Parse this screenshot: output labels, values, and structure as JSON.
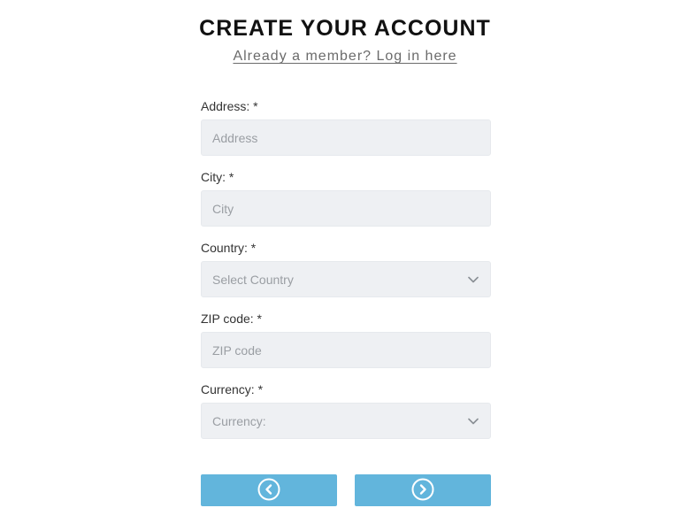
{
  "header": {
    "title": "CREATE YOUR ACCOUNT",
    "login_link": "Already a member? Log in here"
  },
  "form": {
    "address": {
      "label": "Address: *",
      "placeholder": "Address",
      "value": ""
    },
    "city": {
      "label": "City: *",
      "placeholder": "City",
      "value": ""
    },
    "country": {
      "label": "Country: *",
      "selected": "Select Country"
    },
    "zip": {
      "label": "ZIP code: *",
      "placeholder": "ZIP code",
      "value": ""
    },
    "currency": {
      "label": "Currency: *",
      "selected": "Currency:"
    }
  },
  "buttons": {
    "back_icon": "chevron-left-circle-icon",
    "next_icon": "chevron-right-circle-icon"
  },
  "colors": {
    "accent": "#62b5dc",
    "field_bg": "#eef0f3",
    "placeholder": "#9a9ea3"
  }
}
